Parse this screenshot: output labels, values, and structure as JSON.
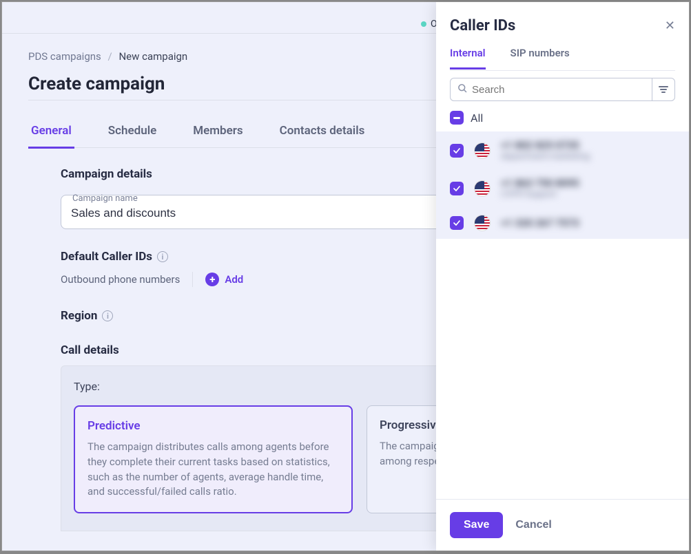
{
  "top": {
    "indicator": "O"
  },
  "breadcrumb": {
    "root": "PDS campaigns",
    "current": "New campaign"
  },
  "page": {
    "title": "Create campaign"
  },
  "tabs": {
    "items": [
      {
        "label": "General"
      },
      {
        "label": "Schedule"
      },
      {
        "label": "Members"
      },
      {
        "label": "Contacts details"
      }
    ]
  },
  "form": {
    "section_campaign_details": "Campaign details",
    "campaign_name_label": "Campaign name",
    "campaign_name_value": "Sales and discounts",
    "section_default_caller_ids": "Default Caller IDs",
    "outbound_label": "Outbound phone numbers",
    "add_label": "Add",
    "section_region": "Region",
    "section_call_details": "Call details",
    "type_label": "Type:",
    "type_predictive_title": "Predictive",
    "type_predictive_desc": "The campaign distributes calls among agents before they complete their current tasks based on statistics, such as the number of agents, average handle time, and successful/failed calls ratio.",
    "type_progressive_title": "Progressive",
    "type_progressive_desc": "The campaign distributes calls among respective number of agents"
  },
  "panel": {
    "title": "Caller IDs",
    "tabs": {
      "internal": "Internal",
      "sip": "SIP numbers"
    },
    "search_placeholder": "Search",
    "all_label": "All",
    "numbers": [
      {
        "primary": "+1 802 825 0735",
        "secondary": "department-marketing"
      },
      {
        "primary": "+1 863 750 8095",
        "secondary": "CVFR Support"
      },
      {
        "primary": "+1 320 267 7573",
        "secondary": ""
      }
    ],
    "save_label": "Save",
    "cancel_label": "Cancel"
  }
}
